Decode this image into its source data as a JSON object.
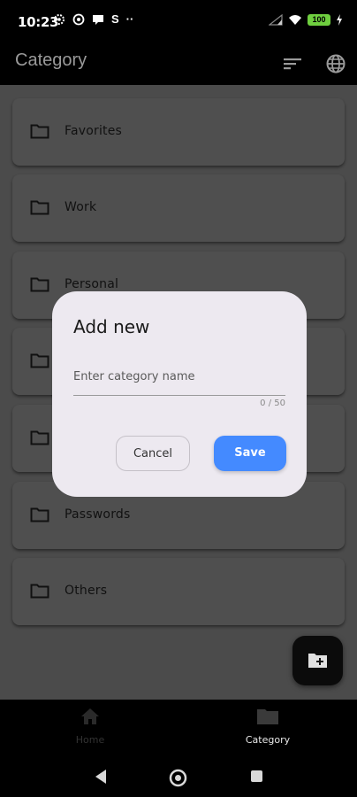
{
  "status_bar": {
    "time": "10:23",
    "icons": [
      "settings-icon",
      "at-icon",
      "chat-icon",
      "s-icon",
      "more-dots-icon"
    ],
    "right_icons": [
      "signal-icon",
      "wifi-icon",
      "battery-icon",
      "charging-icon"
    ],
    "battery": "100"
  },
  "app_bar": {
    "title": "Category",
    "actions": [
      "sort-icon",
      "globe-icon"
    ]
  },
  "categories": [
    {
      "label": "Favorites",
      "icon": "folder-icon"
    },
    {
      "label": "Work",
      "icon": "folder-icon"
    },
    {
      "label": "Personal",
      "icon": "folder-icon"
    },
    {
      "label": "",
      "icon": "folder-icon"
    },
    {
      "label": "",
      "icon": "folder-icon"
    },
    {
      "label": "Passwords",
      "icon": "folder-icon"
    },
    {
      "label": "Others",
      "icon": "folder-icon"
    }
  ],
  "fab": {
    "icon": "add-folder-icon"
  },
  "dialog": {
    "title": "Add new",
    "input_placeholder": "Enter category name",
    "input_value": "",
    "counter": "0 / 50",
    "cancel_label": "Cancel",
    "save_label": "Save",
    "accent": "#448aff"
  },
  "bottom_nav": {
    "items": [
      {
        "label": "Home",
        "icon": "home-icon",
        "active": false
      },
      {
        "label": "Category",
        "icon": "folder-icon",
        "active": true
      }
    ]
  },
  "system_nav": [
    "back-icon",
    "home-circle-icon",
    "recents-icon"
  ]
}
